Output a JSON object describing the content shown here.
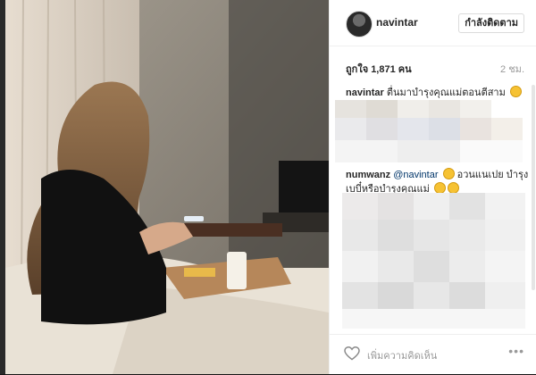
{
  "post": {
    "username": "navintar",
    "follow_label": "กำลังติดตาม",
    "likes": "ถูกใจ 1,871 คน",
    "time_ago": "2 ชม.",
    "add_comment_placeholder": "เพิ่มความคิดเห็น",
    "more_label": "•••"
  },
  "comments": [
    {
      "author": "navintar",
      "text": "ตื่นมาบำรุงคุณแม่ตอนตีสาม"
    },
    {
      "author": "numwanz",
      "mention": "@navintar",
      "text_a": "อวนแนเปย บำรุงเบบี๋หรือบำรุงคุณแม่"
    }
  ],
  "icons": [
    "heart-icon",
    "more-icon",
    "emoji-icon"
  ],
  "colors": {
    "accent_link": "#003569",
    "muted": "#999999"
  }
}
